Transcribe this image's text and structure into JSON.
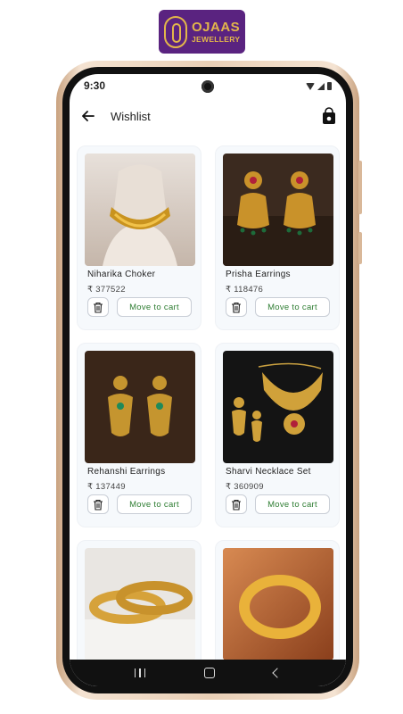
{
  "brand": {
    "line1": "OJAAS",
    "line2": "JEWELLERY"
  },
  "status_bar": {
    "time": "9:30"
  },
  "app_bar": {
    "title": "Wishlist",
    "back_icon": "arrow-left-icon",
    "cart_icon": "shopping-bag-icon"
  },
  "products": [
    {
      "name": "Niharika Choker",
      "price": "₹ 377522",
      "button": "Move to cart"
    },
    {
      "name": "Prisha Earrings",
      "price": "₹ 118476",
      "button": "Move to cart"
    },
    {
      "name": "Rehanshi Earrings",
      "price": "₹ 137449",
      "button": "Move to cart"
    },
    {
      "name": "Sharvi Necklace Set",
      "price": "₹ 360909",
      "button": "Move to cart"
    },
    {
      "name": "",
      "price": "",
      "button": ""
    },
    {
      "name": "",
      "price": "",
      "button": ""
    }
  ],
  "colors": {
    "brand_purple": "#5a2380",
    "gold": "#e2b64a",
    "cart_green": "#2e7d32",
    "card_bg": "#f6f9fc"
  }
}
